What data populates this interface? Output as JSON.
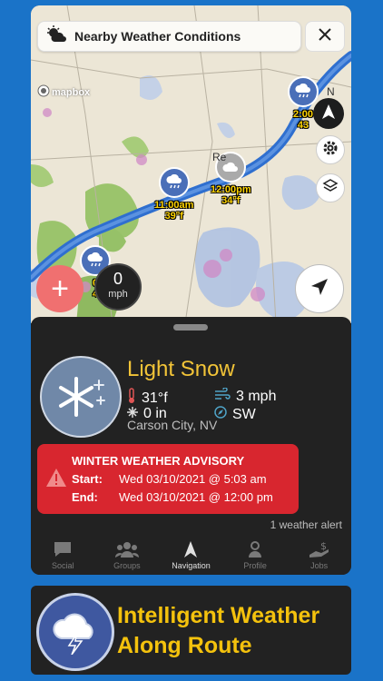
{
  "topbar": {
    "title": "Nearby Weather Conditions"
  },
  "map": {
    "attribution": "mapbox",
    "place_label": "Re",
    "place_label_2": "N",
    "markers": [
      {
        "time": "2:00",
        "temp": "43",
        "icon": "rain-cloud-icon"
      },
      {
        "time": "12:00pm",
        "temp": "34°f",
        "icon": "cloud-icon"
      },
      {
        "time": "11:00am",
        "temp": "39°f",
        "icon": "rain-cloud-icon"
      },
      {
        "time": "0",
        "temp": "4",
        "icon": "rain-cloud-icon"
      }
    ],
    "speed": {
      "value": "0",
      "unit": "mph"
    }
  },
  "current": {
    "condition": "Light Snow",
    "temperature": "31°f",
    "wind_speed": "3 mph",
    "precipitation": "0 in",
    "wind_direction": "SW",
    "location": "Carson City, NV"
  },
  "advisory": {
    "title": "WINTER WEATHER ADVISORY",
    "start_label": "Start:",
    "start_value": "Wed 03/10/2021 @ 5:03 am",
    "end_label": "End:",
    "end_value": "Wed 03/10/2021 @ 12:00 pm"
  },
  "alert_count": "1 weather alert",
  "tabs": [
    {
      "label": "Social",
      "icon": "chat-icon"
    },
    {
      "label": "Groups",
      "icon": "people-icon"
    },
    {
      "label": "Navigation",
      "icon": "navigation-arrow-icon",
      "active": true
    },
    {
      "label": "Profile",
      "icon": "profile-icon"
    },
    {
      "label": "Jobs",
      "icon": "jobs-icon"
    }
  ],
  "banner": {
    "line1": "Intelligent Weather",
    "line2": "Along Route"
  },
  "colors": {
    "accent": "#f2c438",
    "alert": "#d8262f",
    "background": "#1a73c8",
    "route": "#2f6fcf"
  }
}
